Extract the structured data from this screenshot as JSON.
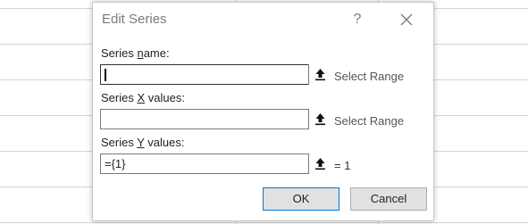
{
  "dialog": {
    "title": "Edit Series",
    "help_label": "?",
    "fields": [
      {
        "label_pre": "Series ",
        "label_accel": "n",
        "label_post": "ame:",
        "value": "",
        "aside": "Select Range"
      },
      {
        "label_pre": "Series ",
        "label_accel": "X",
        "label_post": " values:",
        "value": "",
        "aside": "Select Range"
      },
      {
        "label_pre": "Series ",
        "label_accel": "Y",
        "label_post": " values:",
        "value": "={1}",
        "aside": "= 1"
      }
    ],
    "ok_label": "OK",
    "cancel_label": "Cancel"
  },
  "icons": {
    "help": "question-mark-icon",
    "close": "close-icon",
    "range_select": "collapse-dialog-arrow-icon"
  },
  "colors": {
    "accent_border": "#0078d7",
    "button_bg": "#e1e1e1",
    "grid": "#d4d4d4"
  }
}
